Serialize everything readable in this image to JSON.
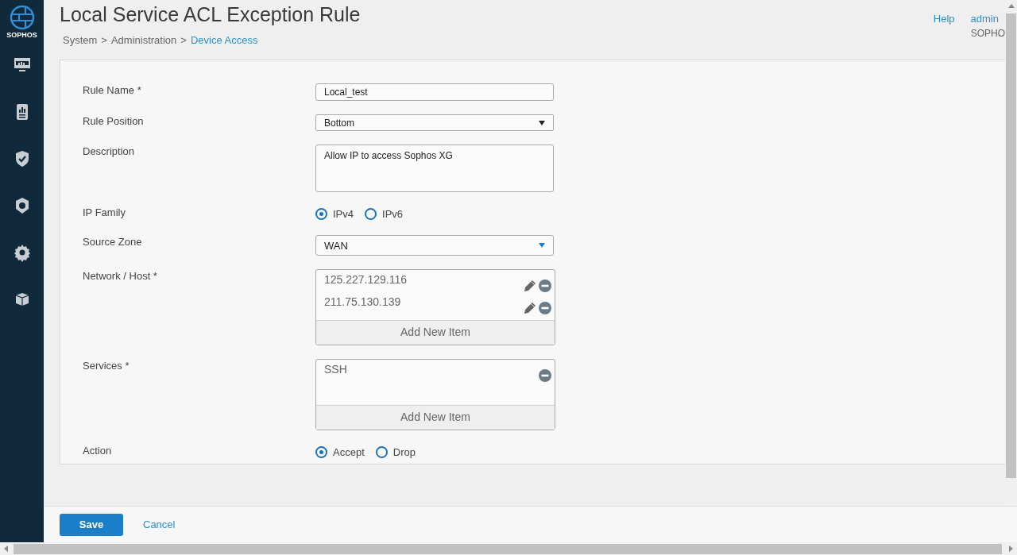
{
  "sidebar": {
    "logo_text": "SOPHOS"
  },
  "header": {
    "title": "Local Service ACL Exception Rule",
    "breadcrumb": [
      {
        "text": "System",
        "kind": "text"
      },
      {
        "text": "Administration",
        "kind": "text"
      },
      {
        "text": "Device Access",
        "kind": "link"
      }
    ],
    "separator": ">",
    "help": "Help",
    "user": "admin",
    "company": "SOPHO"
  },
  "form": {
    "fields": [
      {
        "kind": "text",
        "label": "Rule Name *",
        "value": "Local_test"
      },
      {
        "kind": "select",
        "label": "Rule Position",
        "value": "Bottom"
      },
      {
        "kind": "textarea",
        "label": "Description",
        "value": "Allow IP to access Sophos XG"
      },
      {
        "kind": "radio",
        "label": "IP Family",
        "options": [
          {
            "label": "IPv4",
            "selected": true
          },
          {
            "label": "IPv6",
            "selected": false
          }
        ]
      },
      {
        "kind": "dropdown",
        "label": "Source Zone",
        "value": "WAN"
      },
      {
        "kind": "list",
        "label": "Network / Host *",
        "items": [
          {
            "text": "125.227.129.116",
            "editable": true
          },
          {
            "text": "211.75.130.139",
            "editable": true
          }
        ],
        "add_label": "Add New Item"
      },
      {
        "kind": "list",
        "label": "Services *",
        "items": [
          {
            "text": "SSH",
            "editable": false
          }
        ],
        "add_label": "Add New Item"
      },
      {
        "kind": "radio",
        "label": "Action",
        "options": [
          {
            "label": "Accept",
            "selected": true
          },
          {
            "label": "Drop",
            "selected": false
          }
        ]
      }
    ]
  },
  "footer": {
    "save": "Save",
    "cancel": "Cancel"
  }
}
